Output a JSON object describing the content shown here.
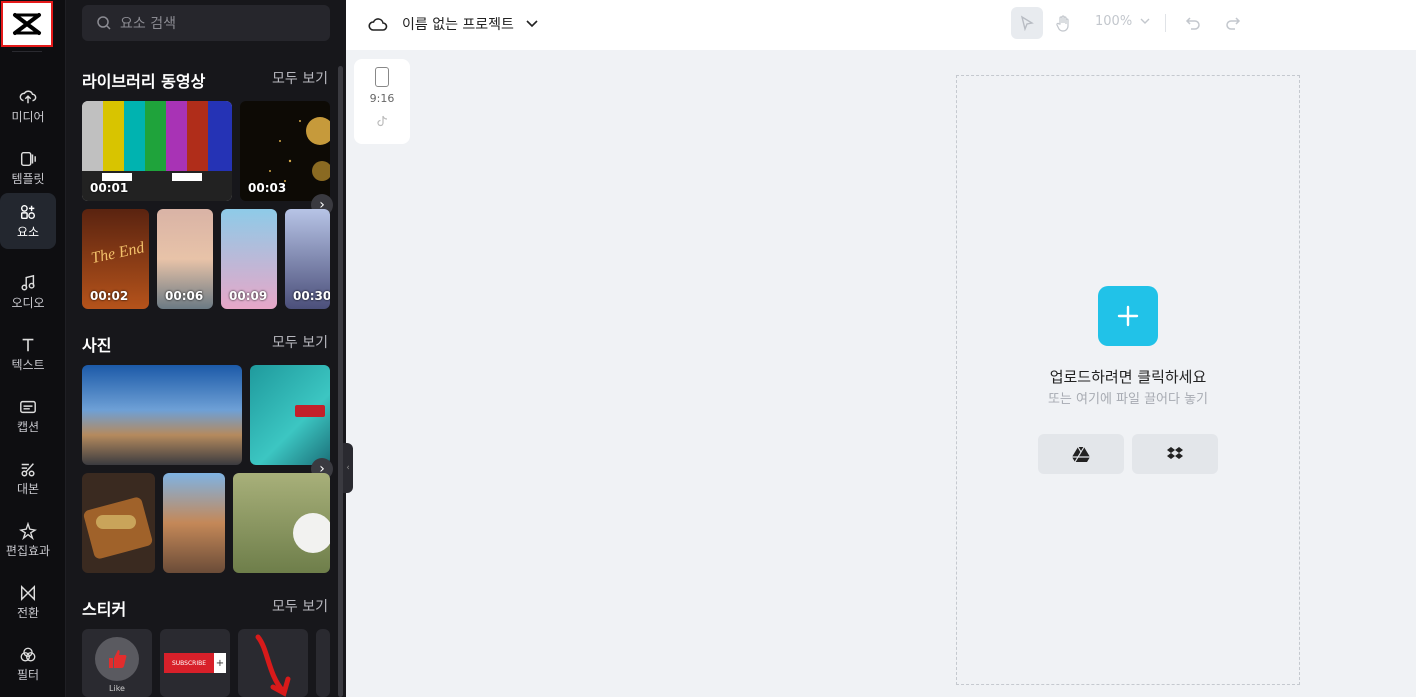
{
  "rail": {
    "items": [
      {
        "label": "미디어",
        "icon": "cloud-upload-icon"
      },
      {
        "label": "템플릿",
        "icon": "template-icon"
      },
      {
        "label": "요소",
        "icon": "elements-icon"
      },
      {
        "label": "오디오",
        "icon": "music-note-icon"
      },
      {
        "label": "텍스트",
        "icon": "text-icon"
      },
      {
        "label": "캡션",
        "icon": "caption-icon"
      },
      {
        "label": "대본",
        "icon": "script-icon"
      },
      {
        "label": "편집효과",
        "icon": "effects-icon"
      },
      {
        "label": "전환",
        "icon": "transition-icon"
      },
      {
        "label": "필터",
        "icon": "filter-icon"
      }
    ]
  },
  "panel": {
    "search_placeholder": "요소 검색",
    "library": {
      "title": "라이브러리 동영상",
      "see_all": "모두 보기",
      "row1": [
        "00:01",
        "00:03"
      ],
      "row2": [
        "00:02",
        "00:06",
        "00:09",
        "00:30"
      ]
    },
    "photos": {
      "title": "사진",
      "see_all": "모두 보기"
    },
    "stickers": {
      "title": "스티커",
      "see_all": "모두 보기",
      "like_label": "Like",
      "subscribe_label": "SUBSCRIBE"
    }
  },
  "topbar": {
    "project_name": "이름 없는 프로젝트",
    "zoom": "100%"
  },
  "canvas": {
    "ratio": "9:16",
    "upload_title": "업로드하려면 클릭하세요",
    "upload_sub": "또는 여기에 파일 끌어다 놓기"
  },
  "colors": {
    "accent": "#21c2e8",
    "highlight": "#e51a1a"
  }
}
